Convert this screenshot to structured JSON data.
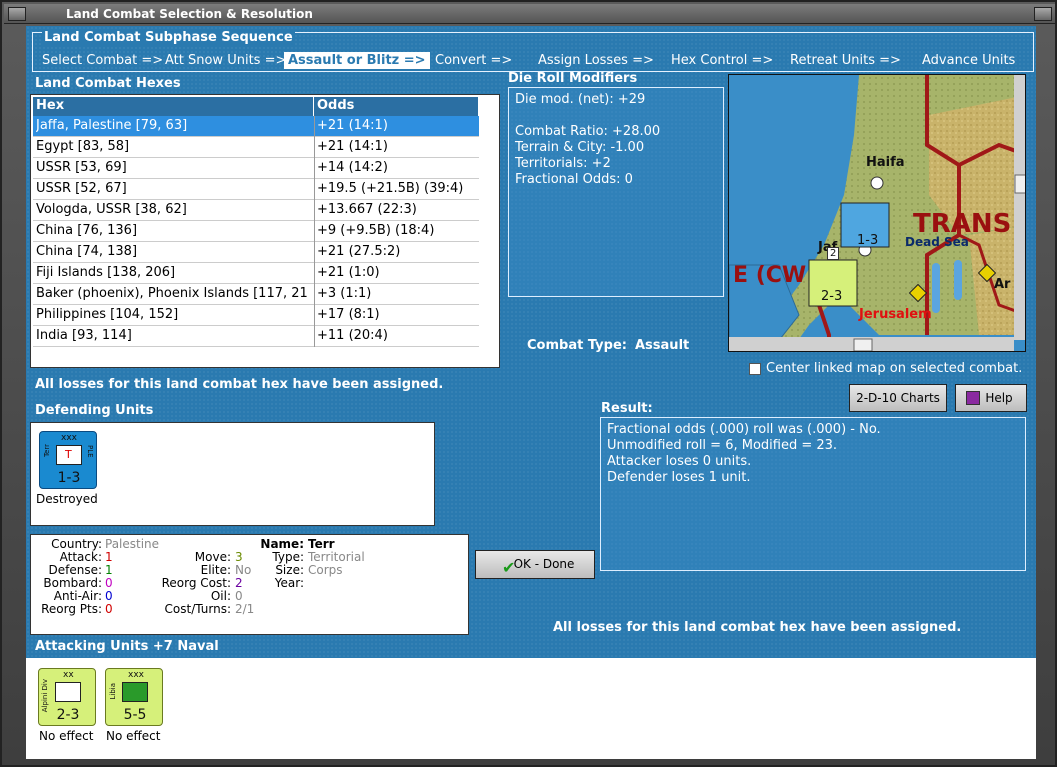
{
  "window": {
    "title": "Land Combat Selection & Resolution"
  },
  "sequence": {
    "title": "Land Combat Subphase Sequence",
    "steps": [
      "Select Combat =>",
      "Att Snow Units =>",
      "Assault or Blitz =>",
      "Convert =>",
      "Assign Losses =>",
      "Hex Control =>",
      "Retreat Units =>",
      "Advance Units"
    ],
    "active_index": 2
  },
  "hexes": {
    "title": "Land Combat Hexes",
    "columns": [
      "Hex",
      "Odds"
    ],
    "rows": [
      {
        "hex": "Jaffa, Palestine [79, 63]",
        "odds": "+21 (14:1)"
      },
      {
        "hex": "Egypt [83, 58]",
        "odds": "+21 (14:1)"
      },
      {
        "hex": "USSR [53, 69]",
        "odds": "+14 (14:2)"
      },
      {
        "hex": "USSR [52, 67]",
        "odds": "+19.5 (+21.5B) (39:4)"
      },
      {
        "hex": "Vologda, USSR [38, 62]",
        "odds": "+13.667 (22:3)"
      },
      {
        "hex": "China [76, 136]",
        "odds": "+9 (+9.5B) (18:4)"
      },
      {
        "hex": "China [74, 138]",
        "odds": "+21 (27.5:2)"
      },
      {
        "hex": "Fiji Islands [138, 206]",
        "odds": "+21 (1:0)"
      },
      {
        "hex": "Baker (phoenix), Phoenix Islands [117, 21",
        "odds": "+3 (1:1)"
      },
      {
        "hex": "Philippines [104, 152]",
        "odds": "+17 (8:1)"
      },
      {
        "hex": "India [93, 114]",
        "odds": "+11 (20:4)"
      }
    ],
    "selected_index": 0
  },
  "modifiers": {
    "title": "Die Roll Modifiers",
    "lines": [
      "Die mod. (net): +29",
      "",
      "Combat Ratio: +28.00",
      "Terrain & City: -1.00",
      "Territorials: +2",
      "Fractional Odds: 0"
    ]
  },
  "map": {
    "labels": {
      "haifa": "Haifa",
      "trans": "TRANS",
      "dead_sea": "Dead Sea",
      "jerusalem": "Jerusalem",
      "ecw": "E (CW",
      "jaf": "Jaf",
      "ar": "Ar"
    },
    "units": {
      "defender_strength": "1-3",
      "attacker_strength": "2-3",
      "stack_count": "2"
    }
  },
  "combat_type": {
    "label": "Combat Type:",
    "value": "Assault"
  },
  "center_map": {
    "label": "Center linked map on selected combat.",
    "checked": false
  },
  "losses_msg_top": "All losses for this land combat hex have been assigned.",
  "losses_msg_bottom": "All losses for this land combat hex have been assigned.",
  "buttons": {
    "charts": "2-D-10 Charts",
    "help": "Help",
    "ok": "OK - Done"
  },
  "defending": {
    "title": "Defending Units",
    "units": [
      {
        "strength": "1-3",
        "size": "xxx",
        "side_left": "Terr",
        "side_right": "PLE",
        "letter": "T",
        "status": "Destroyed"
      }
    ]
  },
  "result": {
    "title": "Result:",
    "lines": [
      "Fractional odds (.000) roll was (.000)  - No.",
      "Unmodified roll = 6, Modified = 23.",
      "Attacker loses 0 units.",
      "Defender loses 1 unit."
    ]
  },
  "details": {
    "country_label": "Country:",
    "country": "Palestine",
    "attack_label": "Attack:",
    "attack": "1",
    "defense_label": "Defense:",
    "defense": "1",
    "bombard_label": "Bombard:",
    "bombard": "0",
    "antiair_label": "Anti-Air:",
    "antiair": "0",
    "reorgpts_label": "Reorg Pts:",
    "reorgpts": "0",
    "move_label": "Move:",
    "move": "3",
    "elite_label": "Elite:",
    "elite": "No",
    "reorgcost_label": "Reorg Cost:",
    "reorgcost": "2",
    "oil_label": "Oil:",
    "oil": "0",
    "costturns_label": "Cost/Turns:",
    "costturns": "2/1",
    "name_label": "Name:",
    "name": "Terr",
    "type_label": "Type:",
    "type": "Territorial",
    "size_label": "Size:",
    "size": "Corps",
    "year_label": "Year:",
    "year": ""
  },
  "attacking": {
    "title": "Attacking Units +7 Naval",
    "units": [
      {
        "strength": "2-3",
        "size": "xx",
        "side_left": "Alpini Div",
        "status": "No effect"
      },
      {
        "strength": "5-5",
        "size": "xxx",
        "side_left": "Libia",
        "status": "No effect"
      }
    ]
  },
  "colors": {
    "panel": "#2a7ab0",
    "selected_row": "#2e8fe0",
    "unit_defender": "#1a8ad0",
    "unit_attacker": "#d6f07a",
    "attack_value": "#d00000",
    "defense_value": "#008000",
    "bombard_value": "#c000c0",
    "antiair_value": "#0000d0"
  }
}
